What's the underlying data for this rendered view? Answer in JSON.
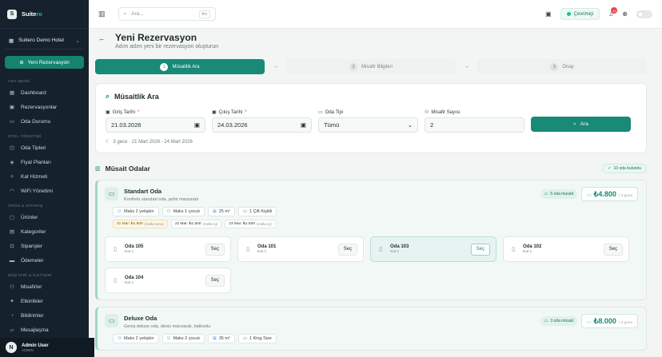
{
  "app": {
    "brand_a": "Suite",
    "brand_b": "ro",
    "logo_letter": "S"
  },
  "sidebar": {
    "hotel": "Suitero Demo Hotel",
    "new_reservation": "Yeni Rezervasyon",
    "sections": [
      {
        "title": "ANA MENÜ",
        "items": [
          {
            "label": "Dashboard",
            "icon": "grid-icon"
          },
          {
            "label": "Rezervasyonlar",
            "icon": "calendar-icon"
          },
          {
            "label": "Oda Durumu",
            "icon": "bed-icon"
          }
        ]
      },
      {
        "title": "OTEL YÖNETİMİ",
        "items": [
          {
            "label": "Oda Tipleri",
            "icon": "layers-icon"
          },
          {
            "label": "Fiyat Planları",
            "icon": "tag-icon"
          },
          {
            "label": "Kat Hizmeti",
            "icon": "sparkle-icon"
          },
          {
            "label": "WiFi Yönetimi",
            "icon": "wifi-icon"
          }
        ]
      },
      {
        "title": "ÜRÜN & SİPARİŞ",
        "items": [
          {
            "label": "Ürünler",
            "icon": "box-icon"
          },
          {
            "label": "Kategoriler",
            "icon": "folder-icon"
          },
          {
            "label": "Siparişler",
            "icon": "cart-icon"
          },
          {
            "label": "Ödemeler",
            "icon": "card-icon"
          }
        ]
      },
      {
        "title": "MÜŞTERİ & İLETİŞİM",
        "items": [
          {
            "label": "Misafirler",
            "icon": "users-icon"
          },
          {
            "label": "Etkinlikler",
            "icon": "event-icon"
          },
          {
            "label": "Bildirimler",
            "icon": "bell-icon"
          },
          {
            "label": "Mesajlaşma",
            "icon": "message-icon"
          }
        ]
      }
    ],
    "user": {
      "initial": "N",
      "name": "Admin User",
      "role": "ADMIN"
    }
  },
  "topbar": {
    "search_placeholder": "Ara...",
    "shortcut": "⌘K",
    "status": "Çevrimiçi",
    "notification_count": "11"
  },
  "page": {
    "title": "Yeni Rezervasyon",
    "subtitle": "Adım adım yeni bir rezervasyon oluşturun",
    "steps": [
      {
        "num": "1",
        "label": "Müsaitlik Ara"
      },
      {
        "num": "2",
        "label": "Misafir Bilgileri"
      },
      {
        "num": "3",
        "label": "Onay"
      }
    ]
  },
  "search_card": {
    "title": "Müsaitlik Ara",
    "checkin_label": "Giriş Tarihi",
    "checkin_value": "21.03.2026",
    "checkout_label": "Çıkış Tarihi",
    "checkout_value": "24.03.2026",
    "room_type_label": "Oda Tipi",
    "room_type_value": "Tümü",
    "guest_label": "Misafir Sayısı",
    "guest_value": "2",
    "search_button": "Ara",
    "nights_text": "3 gece · 21 Mart 2026 - 24 Mart 2026",
    "req": "*"
  },
  "available": {
    "title": "Müsait Odalar",
    "found": "10 oda bulundu",
    "rooms": [
      {
        "name": "Standart Oda",
        "desc": "Konforlu standart oda, şehir manzaralı",
        "available": "5 oda müsait",
        "price": "₺4.800",
        "per": "/ 3 gece",
        "tags": [
          "Maks 2 yetişkin",
          "Maks 1 çocuk",
          "25 m²",
          "1 Çift Kişilik"
        ],
        "rates": [
          {
            "text": "21 Mar: ₺1.800",
            "note": "(Hafta sonu)"
          },
          {
            "text": "22 Mar: ₺1.500",
            "note": "(Hafta içi)"
          },
          {
            "text": "23 Mar: ₺1.500",
            "note": "(Hafta içi)"
          }
        ],
        "units": [
          {
            "name": "Oda 105",
            "floor": "Kat 1"
          },
          {
            "name": "Oda 101",
            "floor": "Kat 1"
          },
          {
            "name": "Oda 103",
            "floor": "Kat 1"
          },
          {
            "name": "Oda 102",
            "floor": "Kat 1"
          },
          {
            "name": "Oda 104",
            "floor": "Kat 1"
          }
        ],
        "select_label": "Seç"
      },
      {
        "name": "Deluxe Oda",
        "desc": "Geniş deluxe oda, deniz manzaralı, balkonlu",
        "available": "3 oda müsait",
        "price": "₺8.000",
        "per": "/ 3 gece",
        "tags": [
          "Maks 2 yetişkin",
          "Maks 2 çocuk",
          "35 m²",
          "1 King Size"
        ]
      }
    ]
  },
  "colors": {
    "accent": "#188a76",
    "sidebar": "#15212c"
  }
}
